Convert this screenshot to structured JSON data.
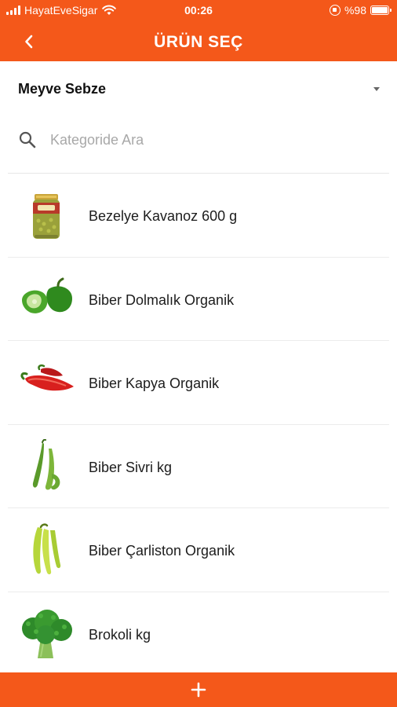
{
  "status_bar": {
    "carrier": "HayatEveSigar",
    "time": "00:26",
    "battery": "%98",
    "battery_level": 0.98
  },
  "header": {
    "title": "ÜRÜN SEÇ",
    "back_icon": "chevron-left-icon"
  },
  "category": {
    "selected": "Meyve Sebze",
    "icon": "caret-down-icon"
  },
  "search": {
    "placeholder": "Kategoride Ara",
    "value": "",
    "icon": "search-icon"
  },
  "products": [
    {
      "name": "Bezelye Kavanoz 600 g",
      "image": "pea-jar"
    },
    {
      "name": "Biber Dolmalık Organik",
      "image": "green-bell-pepper"
    },
    {
      "name": "Biber Kapya Organik",
      "image": "red-kapya-pepper"
    },
    {
      "name": "Biber Sivri kg",
      "image": "green-chili-pepper"
    },
    {
      "name": "Biber Çarliston Organik",
      "image": "charleston-pepper"
    },
    {
      "name": "Brokoli kg",
      "image": "broccoli"
    }
  ],
  "footer": {
    "add_icon": "plus-icon"
  },
  "colors": {
    "accent": "#f4581a",
    "background": "#ffffff",
    "divider": "#e6e6e6",
    "placeholder": "#a8a8a8"
  }
}
